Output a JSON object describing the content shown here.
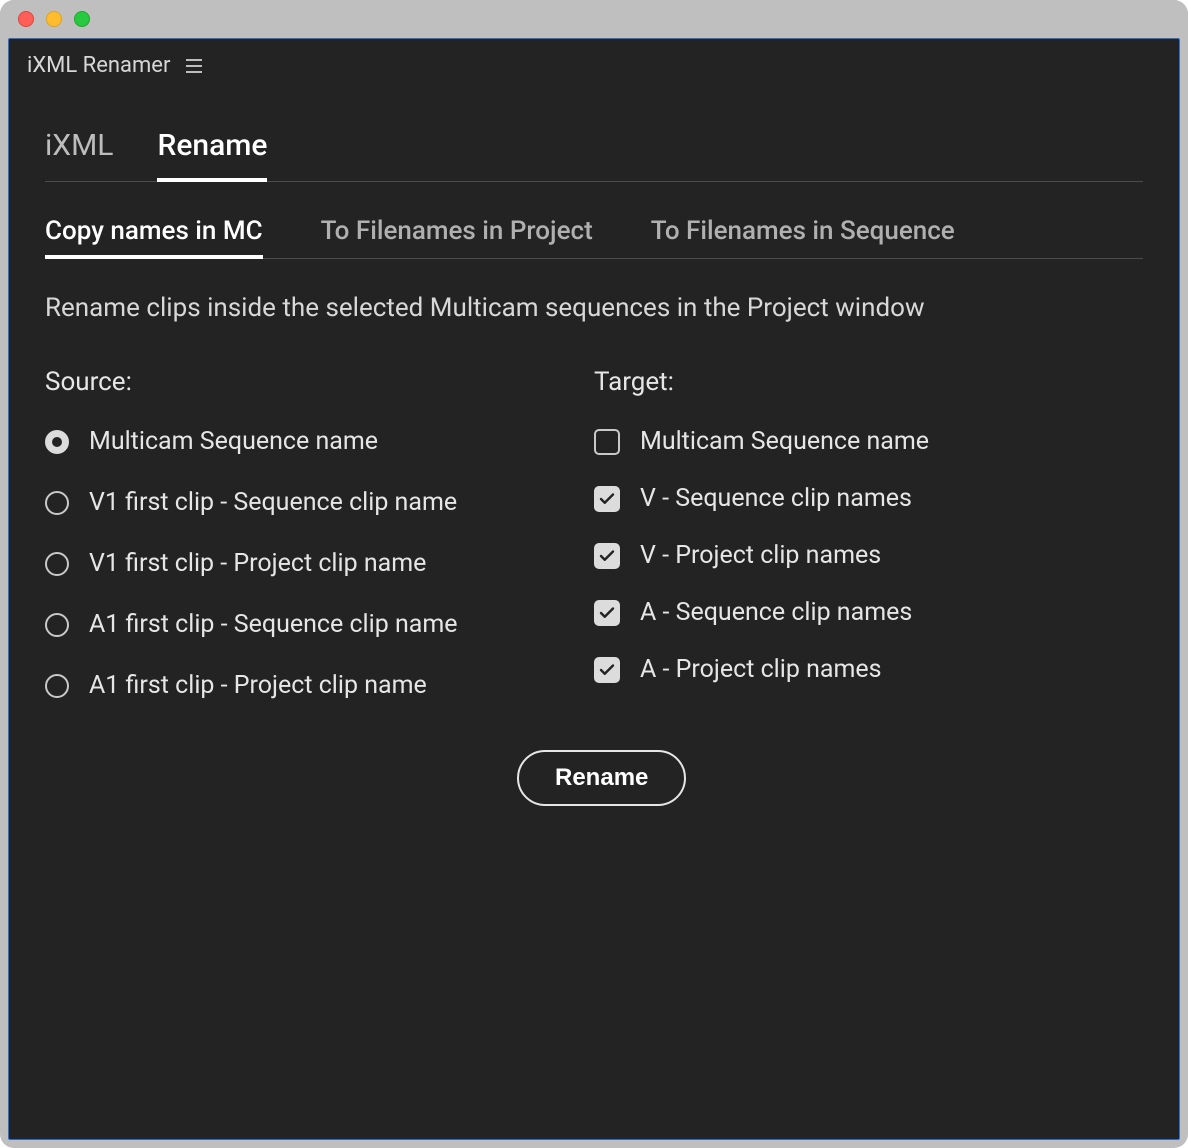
{
  "window": {
    "title": "iXML Renamer"
  },
  "tabs_primary": {
    "items": [
      {
        "label": "iXML",
        "active": false
      },
      {
        "label": "Rename",
        "active": true
      }
    ]
  },
  "tabs_secondary": {
    "items": [
      {
        "label": "Copy names in MC",
        "active": true
      },
      {
        "label": "To Filenames in Project",
        "active": false
      },
      {
        "label": "To Filenames in Sequence",
        "active": false
      }
    ]
  },
  "description": "Rename clips inside the selected Multicam sequences in the Project window",
  "source": {
    "heading": "Source:",
    "options": [
      {
        "label": "Multicam Sequence name",
        "selected": true
      },
      {
        "label": "V1 first clip - Sequence clip name",
        "selected": false
      },
      {
        "label": "V1 first clip - Project clip name",
        "selected": false
      },
      {
        "label": "A1 first clip - Sequence clip name",
        "selected": false
      },
      {
        "label": "A1 first clip - Project clip name",
        "selected": false
      }
    ]
  },
  "target": {
    "heading": "Target:",
    "options": [
      {
        "label": "Multicam Sequence name",
        "checked": false
      },
      {
        "label": "V - Sequence clip names",
        "checked": true
      },
      {
        "label": "V - Project clip names",
        "checked": true
      },
      {
        "label": "A - Sequence clip names",
        "checked": true
      },
      {
        "label": "A - Project clip names",
        "checked": true
      }
    ]
  },
  "action": {
    "rename_label": "Rename"
  }
}
